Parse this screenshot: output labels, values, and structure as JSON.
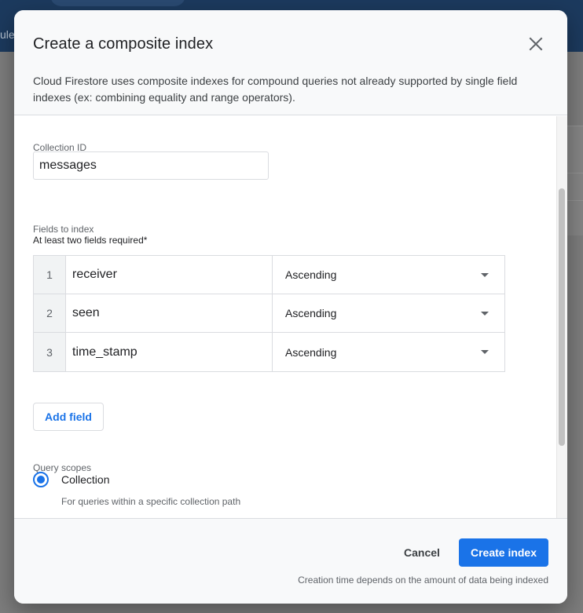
{
  "background": {
    "partial_text": "ule"
  },
  "dialog": {
    "title": "Create a composite index",
    "description": "Cloud Firestore uses composite indexes for compound queries not already supported by single field indexes (ex: combining equality and range operators).",
    "collection": {
      "label": "Collection ID",
      "value": "messages"
    },
    "fields": {
      "label": "Fields to index",
      "requirement": "At least two fields required*",
      "rows": [
        {
          "num": "1",
          "name": "receiver",
          "order": "Ascending"
        },
        {
          "num": "2",
          "name": "seen",
          "order": "Ascending"
        },
        {
          "num": "3",
          "name": "time_stamp",
          "order": "Ascending"
        }
      ],
      "add_label": "Add field"
    },
    "query_scopes": {
      "label": "Query scopes",
      "selected": "Collection",
      "description": "For queries within a specific collection path"
    },
    "footer": {
      "cancel_label": "Cancel",
      "create_label": "Create index",
      "note": "Creation time depends on the amount of data being indexed"
    }
  },
  "colors": {
    "accent": "#1a73e8",
    "overlay": "#7f7f7f"
  }
}
